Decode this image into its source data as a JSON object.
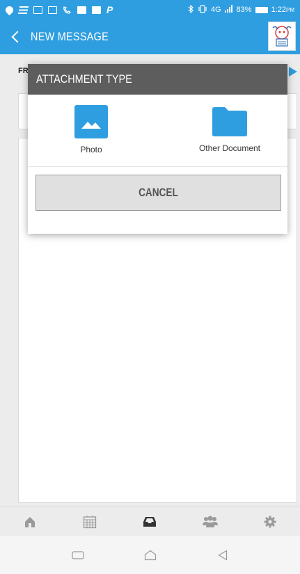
{
  "status_bar": {
    "network": "4G",
    "battery": "83%",
    "time": "1:22",
    "ampm": "PM",
    "icons": [
      "location-pin-icon",
      "notes-icon",
      "mail-icon",
      "mail-icon",
      "voicemail-icon",
      "mail-icon",
      "mail-icon",
      "paypal-icon",
      "bluetooth-icon",
      "vibrate-icon",
      "signal-icon",
      "battery-icon"
    ]
  },
  "app_bar": {
    "title": "NEW MESSAGE",
    "back_icon": "chevron-left-icon",
    "logo": "app-logo"
  },
  "compose": {
    "from_label": "FR"
  },
  "dialog": {
    "title": "ATTACHMENT TYPE",
    "options": [
      {
        "label": "Photo",
        "icon": "photo-icon"
      },
      {
        "label": "Other Document",
        "icon": "folder-icon"
      }
    ],
    "cancel_label": "CANCEL"
  },
  "tab_bar": {
    "tabs": [
      {
        "name": "home",
        "icon": "home-icon",
        "active": false
      },
      {
        "name": "calendar",
        "icon": "calendar-icon",
        "active": false
      },
      {
        "name": "inbox",
        "icon": "inbox-icon",
        "active": true
      },
      {
        "name": "people",
        "icon": "people-icon",
        "active": false
      },
      {
        "name": "settings",
        "icon": "gear-icon",
        "active": false
      }
    ]
  },
  "colors": {
    "brand_blue": "#2f9ee0",
    "dialog_header": "#5d5d5d",
    "active_tab": "#333333",
    "inactive_tab": "#9a9a9a"
  }
}
